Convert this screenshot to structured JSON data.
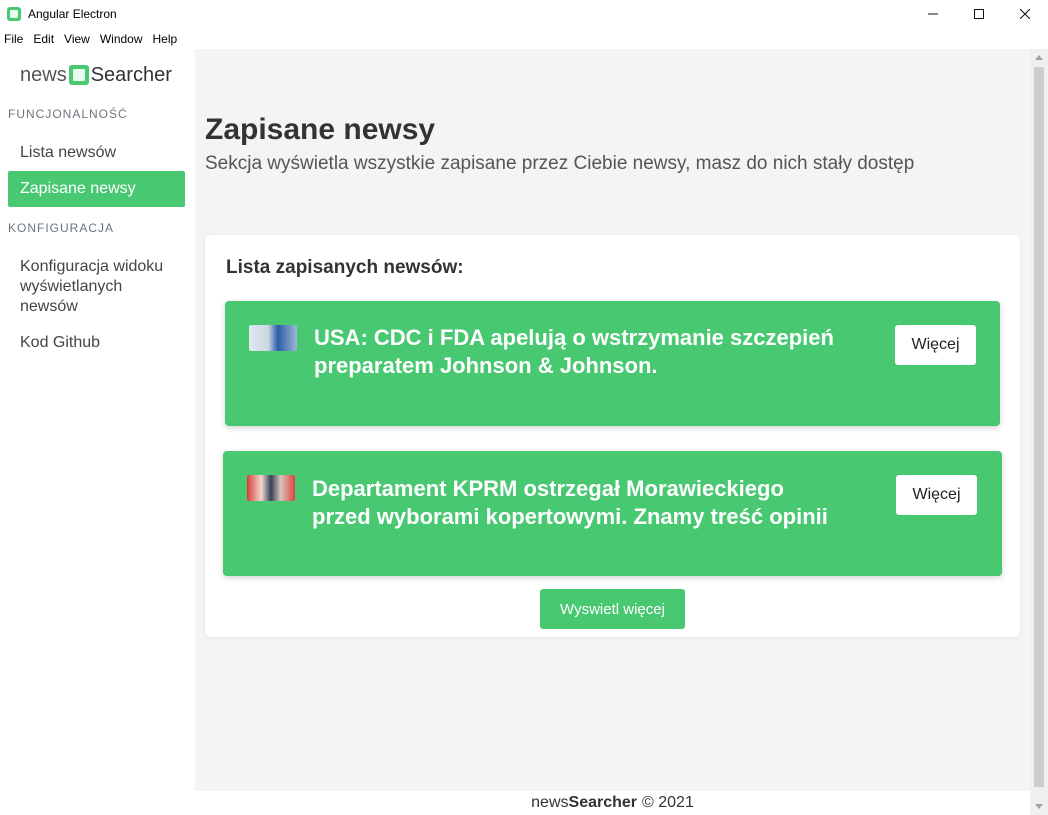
{
  "window": {
    "title": "Angular Electron",
    "menu": [
      "File",
      "Edit",
      "View",
      "Window",
      "Help"
    ]
  },
  "sidebar": {
    "logo": {
      "part1": "news",
      "part2": "Searcher"
    },
    "sections": [
      {
        "header": "FUNCJONALNOŚĆ",
        "items": [
          {
            "label": "Lista newsów",
            "active": false
          },
          {
            "label": "Zapisane newsy",
            "active": true
          }
        ]
      },
      {
        "header": "KONFIGURACJA",
        "items": [
          {
            "label": "Konfiguracja widoku wyświetlanych newsów",
            "active": false
          },
          {
            "label": "Kod Github",
            "active": false
          }
        ]
      }
    ]
  },
  "main": {
    "title": "Zapisane newsy",
    "subtitle": "Sekcja wyświetla wszystkie zapisane przez Ciebie newsy, masz do nich stały dostęp",
    "card": {
      "title": "Lista zapisanych newsów:",
      "news": [
        {
          "title_line1": "USA: CDC i FDA apelują o wstrzymanie szczepień",
          "title_line2": "preparatem Johnson & Johnson.",
          "button": "Więcej"
        },
        {
          "title_line1": "Departament KPRM ostrzegał Morawieckiego",
          "title_line2": "przed wyborami kopertowymi. Znamy treść opinii",
          "button": "Więcej"
        }
      ],
      "show_more": "Wyswietl więcej"
    }
  },
  "footer": {
    "part1": "news",
    "part2": "Searcher",
    "copyright": "© 2021"
  },
  "colors": {
    "accent": "#49c872",
    "background": "#f4f4f4"
  }
}
